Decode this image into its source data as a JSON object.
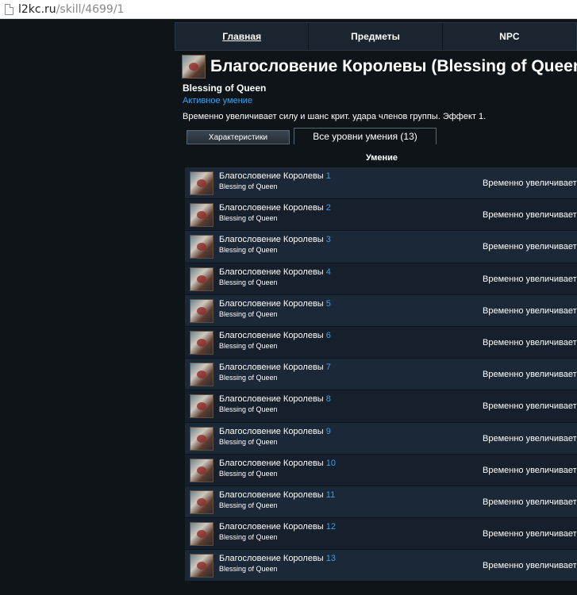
{
  "browser": {
    "url_host": "l2kc.ru",
    "url_path": "/skill/4699/1"
  },
  "nav": {
    "items": [
      {
        "label": "Главная"
      },
      {
        "label": "Предметы"
      },
      {
        "label": "NPC"
      }
    ]
  },
  "skill": {
    "title": "Благословение Королевы (Blessing of Queen)",
    "subtitle": "Blessing of Queen",
    "type": "Активное умение",
    "description": "Временно увеличивает силу и шанс крит. удара членов группы. Эффект 1."
  },
  "tabs": {
    "characteristics": "Характеристики",
    "all_levels": "Все уровни умения (13)"
  },
  "table": {
    "header": "Умение",
    "rows": [
      {
        "name": "Благословение Королевы",
        "level": "1",
        "name_en": "Blessing of Queen",
        "effect": "Временно увеличивает"
      },
      {
        "name": "Благословение Королевы",
        "level": "2",
        "name_en": "Blessing of Queen",
        "effect": "Временно увеличивает"
      },
      {
        "name": "Благословение Королевы",
        "level": "3",
        "name_en": "Blessing of Queen",
        "effect": "Временно увеличивает"
      },
      {
        "name": "Благословение Королевы",
        "level": "4",
        "name_en": "Blessing of Queen",
        "effect": "Временно увеличивает"
      },
      {
        "name": "Благословение Королевы",
        "level": "5",
        "name_en": "Blessing of Queen",
        "effect": "Временно увеличивает"
      },
      {
        "name": "Благословение Королевы",
        "level": "6",
        "name_en": "Blessing of Queen",
        "effect": "Временно увеличивает"
      },
      {
        "name": "Благословение Королевы",
        "level": "7",
        "name_en": "Blessing of Queen",
        "effect": "Временно увеличивает"
      },
      {
        "name": "Благословение Королевы",
        "level": "8",
        "name_en": "Blessing of Queen",
        "effect": "Временно увеличивает"
      },
      {
        "name": "Благословение Королевы",
        "level": "9",
        "name_en": "Blessing of Queen",
        "effect": "Временно увеличивает"
      },
      {
        "name": "Благословение Королевы",
        "level": "10",
        "name_en": "Blessing of Queen",
        "effect": "Временно увеличивает"
      },
      {
        "name": "Благословение Королевы",
        "level": "11",
        "name_en": "Blessing of Queen",
        "effect": "Временно увеличивает"
      },
      {
        "name": "Благословение Королевы",
        "level": "12",
        "name_en": "Blessing of Queen",
        "effect": "Временно увеличивает"
      },
      {
        "name": "Благословение Королевы",
        "level": "13",
        "name_en": "Blessing of Queen",
        "effect": "Временно увеличивает"
      }
    ]
  },
  "colors": {
    "background": "#0f1419",
    "link_accent": "#3aa0e8",
    "row_bg": "#1b2838"
  }
}
